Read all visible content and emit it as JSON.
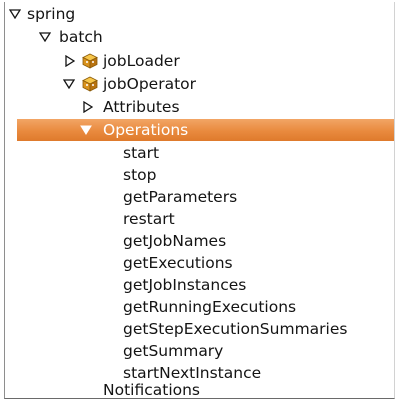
{
  "tree": {
    "root": {
      "label": "spring",
      "expanded": true
    },
    "batch": {
      "label": "batch",
      "expanded": true
    },
    "jobLoader": {
      "label": "jobLoader",
      "expanded": false,
      "icon": "mbean-icon"
    },
    "jobOperator": {
      "label": "jobOperator",
      "expanded": true,
      "icon": "mbean-icon"
    },
    "attributes": {
      "label": "Attributes",
      "expanded": false
    },
    "operations": {
      "label": "Operations",
      "expanded": true,
      "selected": true,
      "items": [
        "start",
        "stop",
        "getParameters",
        "restart",
        "getJobNames",
        "getExecutions",
        "getJobInstances",
        "getRunningExecutions",
        "getStepExecutionSummaries",
        "getSummary",
        "startNextInstance"
      ]
    },
    "notifications": {
      "label": "Notifications"
    }
  },
  "colors": {
    "selection": "#e98a3e",
    "selection_text": "#ffffff",
    "text": "#141414",
    "icon": "#c98a10"
  }
}
